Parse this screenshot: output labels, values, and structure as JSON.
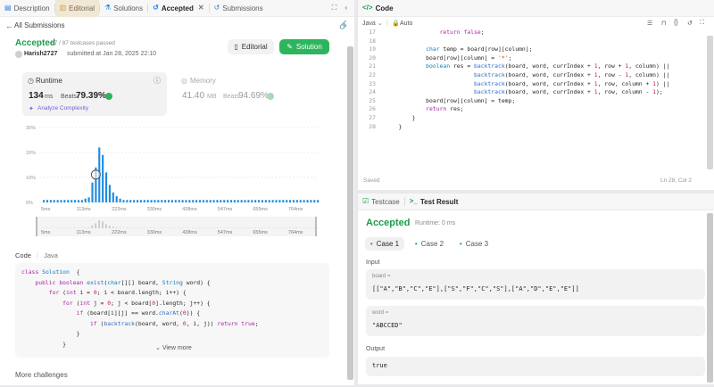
{
  "left_tabs": [
    {
      "label": "Description",
      "icon": "description-icon"
    },
    {
      "label": "Editorial",
      "icon": "editorial-icon"
    },
    {
      "label": "Solutions",
      "icon": "flask-icon"
    },
    {
      "label": "Accepted",
      "icon": "history-icon"
    },
    {
      "label": "Submissions",
      "icon": "history-icon"
    }
  ],
  "back_link": "All Submissions",
  "status": {
    "title": "Accepted",
    "passed": "87 / 87 testcases passed",
    "user": "Harish2727",
    "submitted": "submitted at Jan 28, 2025 22:10"
  },
  "buttons": {
    "editorial": "Editorial",
    "solution": "Solution"
  },
  "runtime": {
    "label": "Runtime",
    "value": "134",
    "unit": "ms",
    "beats": "Beats",
    "percent": "79.39%",
    "analyze": "Analyze Complexity"
  },
  "memory": {
    "label": "Memory",
    "value": "41.40",
    "unit": "MB",
    "beats": "Beats",
    "percent": "94.69%"
  },
  "chart_data": {
    "type": "bar",
    "y_ticks": [
      "30%",
      "20%",
      "10%",
      "0%"
    ],
    "ylim": [
      0,
      30
    ],
    "x_ticks": [
      "5ms",
      "113ms",
      "222ms",
      "330ms",
      "438ms",
      "547ms",
      "655ms",
      "764ms"
    ],
    "range_ticks": [
      "5ms",
      "113ms",
      "222ms",
      "330ms",
      "438ms",
      "547ms",
      "655ms",
      "764ms"
    ],
    "values": [
      1,
      1,
      1,
      1,
      1,
      1,
      1,
      1,
      1,
      1,
      1,
      1,
      1.5,
      2,
      8,
      14,
      22,
      19,
      12,
      7,
      4,
      2.5,
      1.5,
      1,
      1,
      1,
      1,
      1,
      1,
      1,
      1,
      1,
      1,
      1,
      1,
      1,
      1,
      1,
      1,
      1,
      1,
      1,
      1,
      1,
      1,
      1,
      1,
      1,
      1,
      1,
      1,
      1,
      1,
      1,
      1,
      1,
      1,
      1,
      1,
      1,
      1,
      1,
      1,
      1,
      1,
      1,
      1,
      1,
      1,
      1,
      1,
      1,
      1,
      1,
      1,
      1,
      1,
      1,
      1,
      1
    ],
    "highlight_index": 15
  },
  "code_section": {
    "label": "Code",
    "lang": "Java",
    "view_more": "View more"
  },
  "more": "More challenges",
  "left_code": [
    [
      [
        "kw",
        "class "
      ],
      [
        "ty",
        "Solution"
      ],
      [
        "",
        "  {"
      ]
    ],
    [
      [
        "",
        "    "
      ],
      [
        "kw",
        "public boolean "
      ],
      [
        "fn",
        "exist"
      ],
      [
        "",
        "("
      ],
      [
        "ty",
        "char"
      ],
      [
        "",
        "[][] board, "
      ],
      [
        "ty",
        "String"
      ],
      [
        "",
        " word) {"
      ]
    ],
    [
      [
        "",
        "        "
      ],
      [
        "kw",
        "for "
      ],
      [
        "",
        "("
      ],
      [
        "kw",
        "int "
      ],
      [
        "",
        "i = "
      ],
      [
        "num",
        "0"
      ],
      [
        "",
        "; i < board.length; i++) {"
      ]
    ],
    [
      [
        "",
        "            "
      ],
      [
        "kw",
        "for "
      ],
      [
        "",
        "("
      ],
      [
        "kw",
        "int "
      ],
      [
        "",
        "j = "
      ],
      [
        "num",
        "0"
      ],
      [
        "",
        "; j < board["
      ],
      [
        "num",
        "0"
      ],
      [
        "",
        "].length; j++) {"
      ]
    ],
    [
      [
        "",
        "                "
      ],
      [
        "kw",
        "if "
      ],
      [
        "",
        "(board[i][j] == word."
      ],
      [
        "fn",
        "charAt"
      ],
      [
        "",
        "("
      ],
      [
        "num",
        "0"
      ],
      [
        "",
        ")) {"
      ]
    ],
    [
      [
        "",
        "                    "
      ],
      [
        "kw",
        "if "
      ],
      [
        "",
        "("
      ],
      [
        "fn",
        "backtrack"
      ],
      [
        "",
        "(board, word, "
      ],
      [
        "num",
        "0"
      ],
      [
        "",
        ", i, j)) "
      ],
      [
        "kw",
        "return true"
      ],
      [
        "",
        ";"
      ]
    ],
    [
      [
        "",
        "                }"
      ]
    ],
    [
      [
        "",
        "            }"
      ]
    ]
  ],
  "code_panel": {
    "title": "Code",
    "lang": "Java",
    "mode": "Auto",
    "saved": "Saved",
    "position": "Ln 28, Col 2"
  },
  "editor_lines": [
    {
      "n": "17",
      "t": [
        [
          "",
          "                "
        ],
        [
          "kw",
          "return false"
        ],
        [
          "",
          ";"
        ]
      ]
    },
    {
      "n": "18",
      "t": []
    },
    {
      "n": "19",
      "t": [
        [
          "",
          "            "
        ],
        [
          "ty",
          "char "
        ],
        [
          "",
          "temp = board[row][column];"
        ]
      ]
    },
    {
      "n": "20",
      "t": [
        [
          "",
          "            board[row][column] = "
        ],
        [
          "str",
          "'*'"
        ],
        [
          "",
          ";"
        ]
      ]
    },
    {
      "n": "21",
      "t": [
        [
          "",
          "            "
        ],
        [
          "ty",
          "boolean "
        ],
        [
          "",
          "res = "
        ],
        [
          "fn",
          "backtrack"
        ],
        [
          "",
          "(board, word, currIndex + "
        ],
        [
          "num",
          "1"
        ],
        [
          "",
          ", row + "
        ],
        [
          "num",
          "1"
        ],
        [
          "",
          ", column) ||"
        ]
      ]
    },
    {
      "n": "22",
      "t": [
        [
          "",
          "                          "
        ],
        [
          "fn",
          "backtrack"
        ],
        [
          "",
          "(board, word, currIndex + "
        ],
        [
          "num",
          "1"
        ],
        [
          "",
          ", row - "
        ],
        [
          "num",
          "1"
        ],
        [
          "",
          ", column) ||"
        ]
      ]
    },
    {
      "n": "23",
      "t": [
        [
          "",
          "                          "
        ],
        [
          "fn",
          "backtrack"
        ],
        [
          "",
          "(board, word, currIndex + "
        ],
        [
          "num",
          "1"
        ],
        [
          "",
          ", row, column + "
        ],
        [
          "num",
          "1"
        ],
        [
          "",
          ") ||"
        ]
      ]
    },
    {
      "n": "24",
      "t": [
        [
          "",
          "                          "
        ],
        [
          "fn",
          "backtrack"
        ],
        [
          "",
          "(board, word, currIndex + "
        ],
        [
          "num",
          "1"
        ],
        [
          "",
          ", row, column - "
        ],
        [
          "num",
          "1"
        ],
        [
          "",
          ");"
        ]
      ]
    },
    {
      "n": "25",
      "t": [
        [
          "",
          "            board[row][column] = temp;"
        ]
      ]
    },
    {
      "n": "26",
      "t": [
        [
          "",
          "            "
        ],
        [
          "kw",
          "return "
        ],
        [
          "",
          "res;"
        ]
      ]
    },
    {
      "n": "27",
      "t": [
        [
          "",
          "        }"
        ]
      ]
    },
    {
      "n": "28",
      "t": [
        [
          "",
          "    }"
        ]
      ]
    }
  ],
  "test_panel": {
    "tab1": "Testcase",
    "tab2": "Test Result",
    "status": "Accepted",
    "runtime": "Runtime: 0 ms",
    "cases": [
      "Case 1",
      "Case 2",
      "Case 3"
    ],
    "input_label": "Input",
    "board_label": "board =",
    "board_value": "[[\"A\",\"B\",\"C\",\"E\"],[\"S\",\"F\",\"C\",\"S\"],[\"A\",\"D\",\"E\",\"E\"]]",
    "word_label": "word =",
    "word_value": "\"ABCCED\"",
    "output_label": "Output",
    "output_value": "true"
  },
  "colors": {
    "accent_green": "#2db55d",
    "accepted_green": "#1b9e4b",
    "bar_blue": "#1d8be0"
  }
}
